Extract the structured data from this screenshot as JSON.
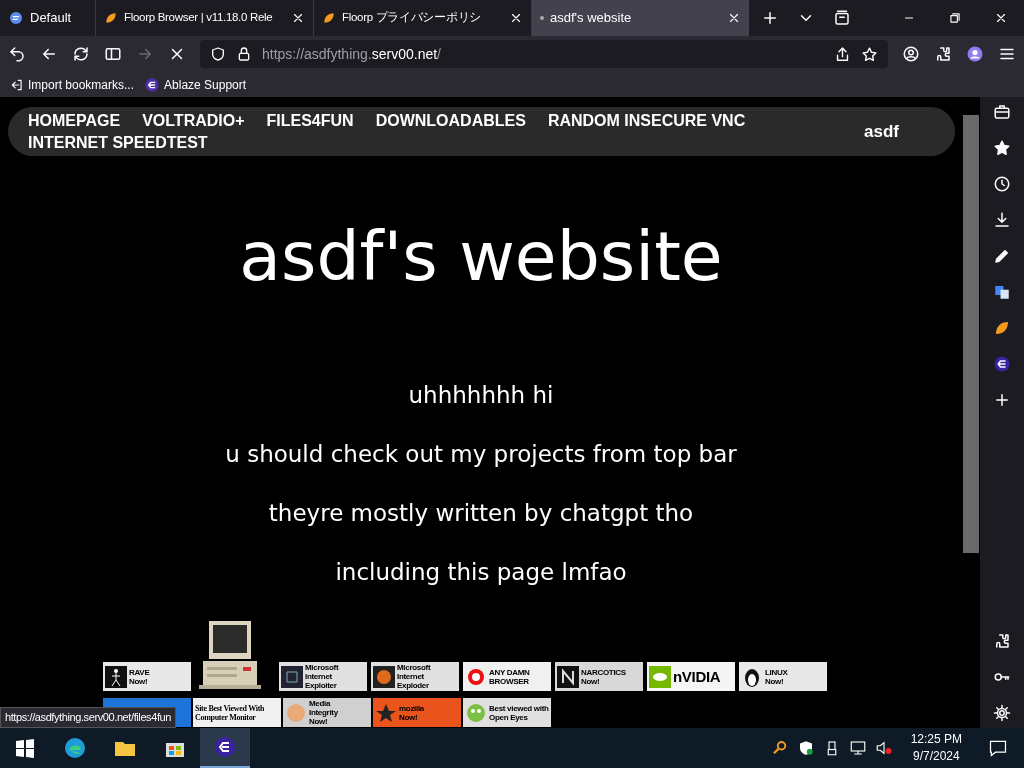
{
  "tabs": [
    {
      "label": "Default",
      "kind": "workspace",
      "selected": false
    },
    {
      "label": "Floorp Browser | v11.18.0 Rele",
      "kind": "page",
      "selected": false
    },
    {
      "label": "Floorp プライバシーポリシ",
      "kind": "page",
      "selected": false
    },
    {
      "label": "asdf's website",
      "kind": "loading",
      "selected": true
    }
  ],
  "address": {
    "prefix": "https://asdfything.",
    "domain": "serv00.net",
    "suffix": "/"
  },
  "bookmarks": [
    {
      "label": "Import bookmarks...",
      "kind": "import"
    },
    {
      "label": "Ablaze Support",
      "kind": "ablaze"
    }
  ],
  "nav": {
    "links": [
      "HOMEPAGE",
      "VOLTRADIO+",
      "FILES4FUN",
      "DOWNLOADABLES",
      "RANDOM INSECURE VNC",
      "INTERNET SPEEDTEST"
    ],
    "brand": "asdf"
  },
  "heading": "asdf's website",
  "paragraphs": [
    "uhhhhhhh hi",
    "u should check out my projects from top bar",
    "theyre mostly written by chatgpt tho",
    "including this page lmfao"
  ],
  "badges_row_1": [
    {
      "kind": "rave",
      "lines": [
        "RAVE",
        "Now!"
      ]
    },
    {
      "kind": "picture"
    },
    {
      "kind": "exploiter",
      "lines": [
        "Microsoft",
        "Internet",
        "Exploiter"
      ]
    },
    {
      "kind": "exploder",
      "lines": [
        "Microsoft",
        "Internet",
        "Exploder"
      ]
    },
    {
      "kind": "anydamn",
      "lines": [
        "ANY DAMN",
        "BROWSER"
      ]
    },
    {
      "kind": "narcotics",
      "lines": [
        "NARCOTICS",
        "Now!"
      ]
    },
    {
      "kind": "nvidia",
      "lines": [
        "nVIDIA"
      ]
    },
    {
      "kind": "linux",
      "lines": [
        "LINUX",
        "Now!"
      ]
    }
  ],
  "badges_row_2": [
    {
      "kind": "ms"
    },
    {
      "kind": "monitor",
      "lines": [
        "Site Best Viewed With",
        "Computer Monitor"
      ]
    },
    {
      "kind": "media",
      "lines": [
        "Media",
        "Integrity",
        "Now!"
      ]
    },
    {
      "kind": "mozilla",
      "lines": [
        "mozilla",
        "Now!"
      ]
    },
    {
      "kind": "eyes",
      "lines": [
        "Best viewed with",
        "Open Eyes"
      ]
    }
  ],
  "status_link": "https://asdfything.serv00.net/files4fun",
  "clock": {
    "time": "12:25 PM",
    "date": "9/7/2024"
  }
}
